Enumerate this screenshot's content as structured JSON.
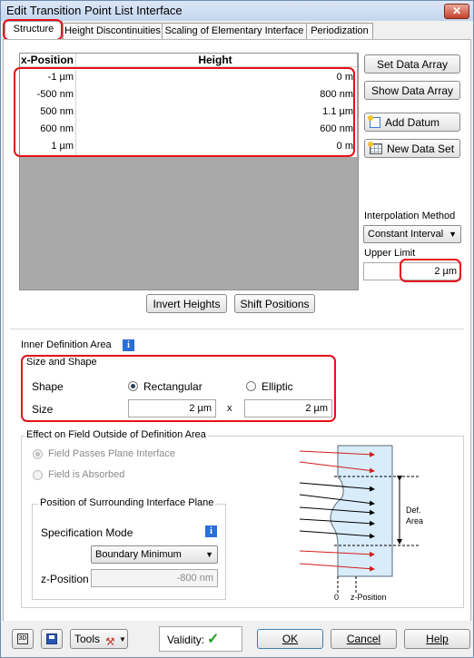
{
  "window": {
    "title": "Edit Transition Point List Interface",
    "close_glyph": "✕"
  },
  "tabs": [
    {
      "label": "Structure"
    },
    {
      "label": "Height Discontinuities"
    },
    {
      "label": "Scaling of Elementary Interface"
    },
    {
      "label": "Periodization"
    }
  ],
  "table": {
    "headers": [
      "x-Position",
      "Height"
    ],
    "rows": [
      {
        "x": "-1 µm",
        "h": "0 m"
      },
      {
        "x": "-500 nm",
        "h": "800 nm"
      },
      {
        "x": "500 nm",
        "h": "1.1 µm"
      },
      {
        "x": "600 nm",
        "h": "600 nm"
      },
      {
        "x": "1 µm",
        "h": "0 m"
      }
    ]
  },
  "side": {
    "set_data_array": "Set Data Array",
    "show_data_array": "Show Data Array",
    "add_datum": "Add Datum",
    "new_data_set": "New Data Set",
    "interpolation_label": "Interpolation Method",
    "interpolation_value": "Constant Interval",
    "upper_limit_label": "Upper Limit",
    "upper_limit_value": "2 µm"
  },
  "actions": {
    "invert_heights": "Invert Heights",
    "shift_positions": "Shift Positions"
  },
  "inner": {
    "title": "Inner Definition Area",
    "size_shape_title": "Size and Shape",
    "shape_label": "Shape",
    "rect_label": "Rectangular",
    "elliptic_label": "Elliptic",
    "size_label": "Size",
    "size_x": "2 µm",
    "times": "x",
    "size_y": "2 µm"
  },
  "effect": {
    "title": "Effect on Field Outside of Definition Area",
    "passes_label": "Field Passes Plane Interface",
    "absorbed_label": "Field is Absorbed",
    "position_title": "Position of Surrounding Interface Plane",
    "spec_mode_label": "Specification Mode",
    "spec_mode_value": "Boundary Minimum",
    "zpos_label": "z-Position",
    "zpos_value": "-800 nm"
  },
  "diagram": {
    "def_label_1": "Def.",
    "def_label_2": "Area",
    "zero": "0",
    "zpos": "z-Position"
  },
  "footer": {
    "tools": "Tools",
    "validity_label": "Validity:",
    "validity_mark": "✓",
    "ok": "OK",
    "cancel": "Cancel",
    "help": "Help"
  },
  "colors": {
    "highlight": "#e8101a",
    "grid_empty": "#a9a9a9",
    "valid": "#1f9e1f",
    "info": "#2a6fd6"
  }
}
